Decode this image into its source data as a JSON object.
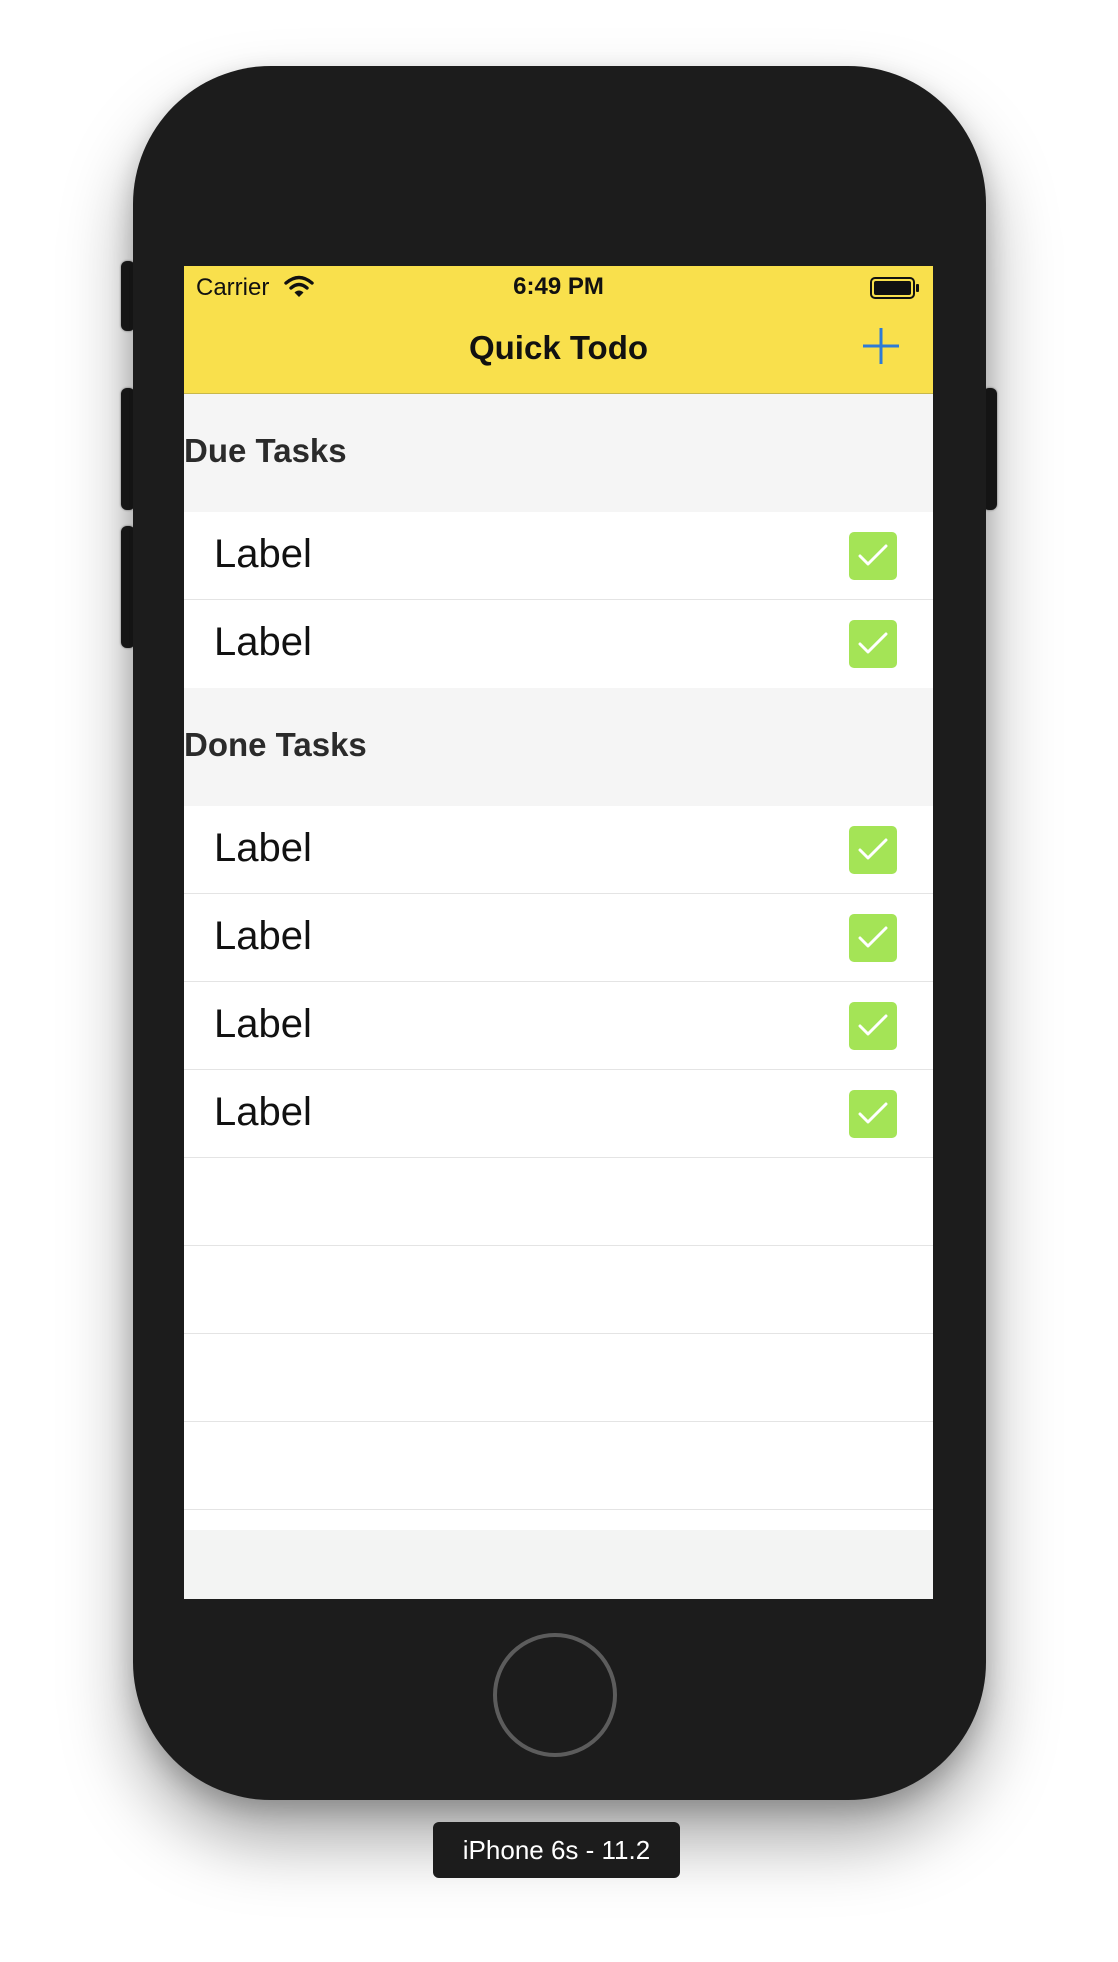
{
  "status_bar": {
    "carrier": "Carrier",
    "time": "6:49 PM"
  },
  "nav": {
    "title": "Quick Todo",
    "add_icon": "plus-icon"
  },
  "sections": [
    {
      "title": "Due Tasks",
      "items": [
        {
          "label": "Label",
          "checked": true
        },
        {
          "label": "Label",
          "checked": true
        }
      ]
    },
    {
      "title": "Done Tasks",
      "items": [
        {
          "label": "Label",
          "checked": true
        },
        {
          "label": "Label",
          "checked": true
        },
        {
          "label": "Label",
          "checked": true
        },
        {
          "label": "Label",
          "checked": true
        }
      ]
    }
  ],
  "device_label": "iPhone 6s - 11.2",
  "colors": {
    "nav_bar": "#f9e04c",
    "checkbox": "#a4e456",
    "accent": "#2e7bd6"
  }
}
